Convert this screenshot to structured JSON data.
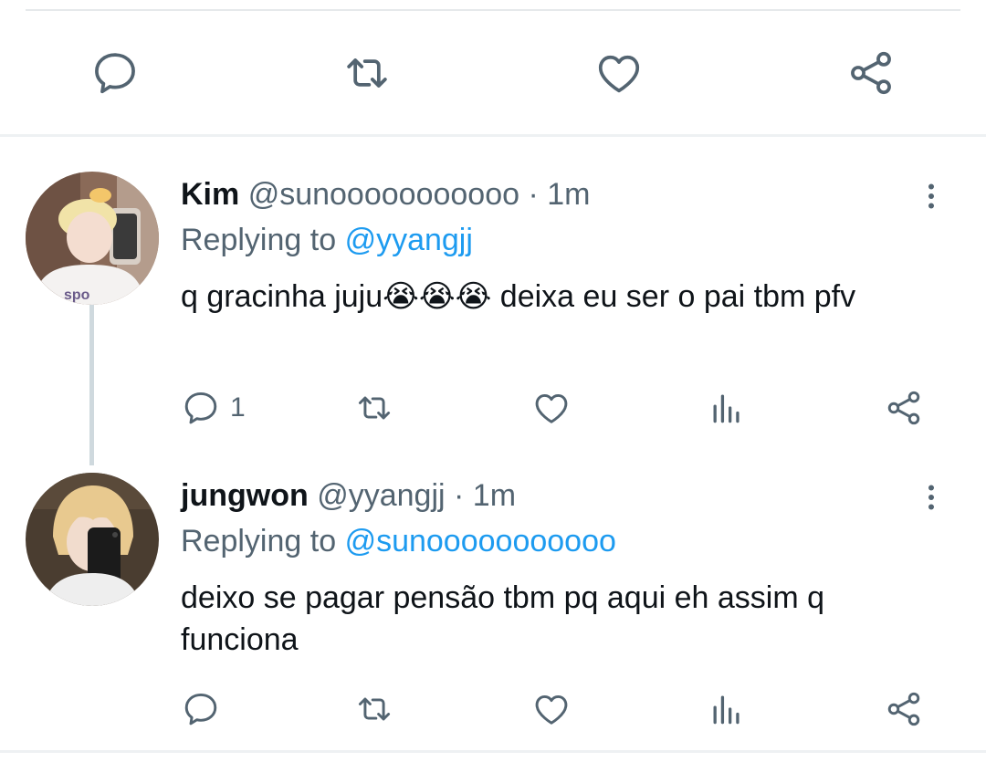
{
  "colors": {
    "icon": "#536471",
    "link": "#1d9bf0",
    "text": "#0f1419",
    "divider": "#e6e9eb"
  },
  "main_actions": {
    "icons": [
      "reply-icon",
      "retweet-icon",
      "like-icon",
      "share-icon"
    ]
  },
  "replies": [
    {
      "name": "Kim",
      "handle": "@sunooooooooooo",
      "dot": "·",
      "time": "1m",
      "replying_prefix": "Replying to",
      "replying_to": "@yyangjj",
      "text_before_emoji": "q gracinha juju",
      "emojis": [
        "😭",
        "😭",
        "😭"
      ],
      "text_after_emoji": " deixa eu ser o pai tbm pfv",
      "reply_count": "1",
      "icons": [
        "reply-icon",
        "retweet-icon",
        "like-icon",
        "analytics-icon",
        "share-icon",
        "more-icon"
      ]
    },
    {
      "name": "jungwon",
      "handle": "@yyangjj",
      "dot": "·",
      "time": "1m",
      "replying_prefix": "Replying to",
      "replying_to": "@sunooooooooooo",
      "text": "deixo se pagar pensão tbm pq aqui eh assim q funciona",
      "icons": [
        "reply-icon",
        "retweet-icon",
        "like-icon",
        "analytics-icon",
        "share-icon",
        "more-icon"
      ]
    }
  ]
}
